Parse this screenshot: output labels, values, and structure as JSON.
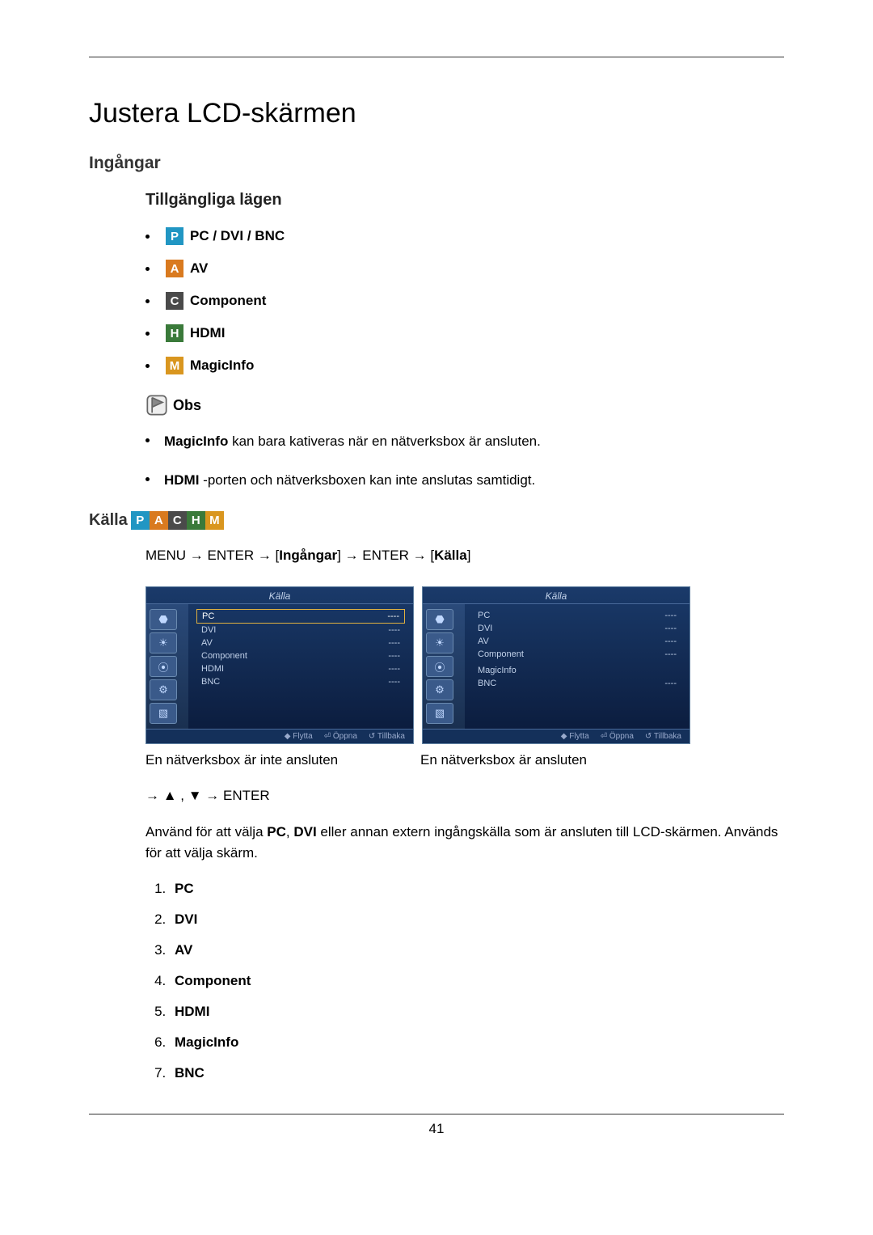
{
  "title": "Justera LCD-skärmen",
  "inputs_heading": "Ingångar",
  "modes_heading": "Tillgängliga lägen",
  "modes": [
    {
      "badge": "P",
      "label": "PC / DVI / BNC"
    },
    {
      "badge": "A",
      "label": "AV"
    },
    {
      "badge": "C",
      "label": "Component"
    },
    {
      "badge": "H",
      "label": "HDMI"
    },
    {
      "badge": "M",
      "label": "MagicInfo"
    }
  ],
  "note_label": "Obs",
  "notes": {
    "n1_b": "MagicInfo",
    "n1_rest": " kan bara kativeras när en nätverksbox är ansluten.",
    "n2_b": "HDMI",
    "n2_rest": " -porten och nätverksboxen kan inte anslutas samtidigt."
  },
  "kalla_heading": "Källa",
  "menu_path": {
    "p1": "MENU → ENTER → [",
    "p2": "Ingångar",
    "p3": "] → ENTER → [",
    "p4": "Källa",
    "p5": "]"
  },
  "osd": {
    "title": "Källa",
    "footer": {
      "flytta": "Flytta",
      "oppna": "Öppna",
      "tillbaka": "Tillbaka"
    },
    "left": {
      "items": [
        "PC",
        "DVI",
        "AV",
        "Component",
        "HDMI",
        "BNC"
      ],
      "vals": [
        "----",
        "----",
        "----",
        "----",
        "----",
        "----"
      ],
      "selected": 0,
      "caption": "En nätverksbox är inte ansluten"
    },
    "right": {
      "items": [
        "PC",
        "DVI",
        "AV",
        "Component",
        "",
        "MagicInfo",
        "BNC"
      ],
      "vals": [
        "----",
        "----",
        "----",
        "----",
        "",
        "",
        "----"
      ],
      "selected": -1,
      "caption": "En nätverksbox är ansluten"
    }
  },
  "nav_keys": "→ ▲ , ▼ → ENTER",
  "usage": {
    "pre": "Använd för att välja ",
    "b1": "PC",
    "mid1": ", ",
    "b2": "DVI",
    "post": " eller annan extern ingångskälla som är ansluten till LCD-skärmen. Används för att välja skärm."
  },
  "source_list": [
    "PC",
    "DVI",
    "AV",
    "Component",
    "HDMI",
    "MagicInfo",
    "BNC"
  ],
  "page_number": "41"
}
